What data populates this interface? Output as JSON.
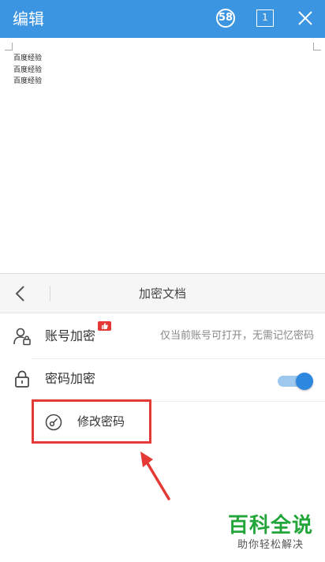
{
  "topbar": {
    "title": "编辑",
    "badge_count": "58",
    "page_number": "1"
  },
  "document": {
    "lines": [
      "百度经验",
      "百度经验",
      "百度经验"
    ]
  },
  "sheet": {
    "title": "加密文档",
    "account_row": {
      "label": "账号加密",
      "description": "仅当前账号可打开，无需记忆密码"
    },
    "password_row": {
      "label": "密码加密",
      "toggle_on": true
    },
    "change_password": {
      "label": "修改密码"
    }
  },
  "watermark": {
    "main": "百科全说",
    "sub": "助你轻松解决"
  },
  "colors": {
    "topbar": "#3b95e0",
    "accent": "#2f88df",
    "highlight": "#e53935",
    "watermark": "#22a63a"
  },
  "icons": {
    "back": "chevron-left-icon",
    "close": "close-icon",
    "account": "user-lock-icon",
    "password": "lock-icon",
    "change_password": "key-icon"
  }
}
